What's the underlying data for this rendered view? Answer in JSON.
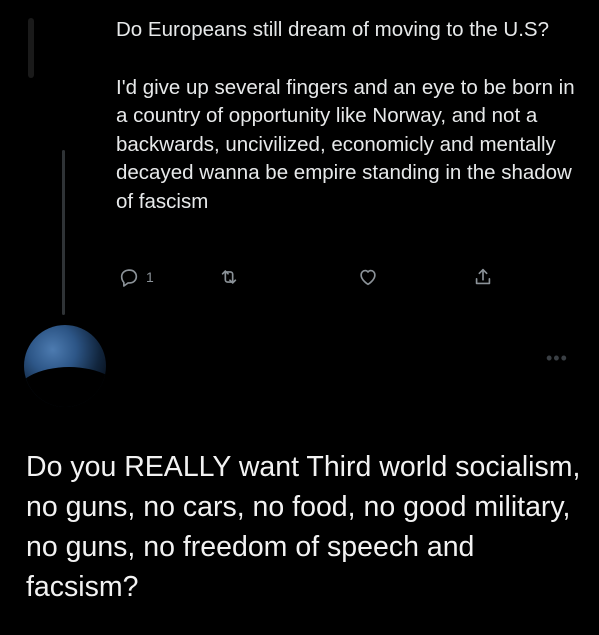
{
  "tweet": {
    "paragraph1": "Do Europeans still dream of moving to the U.S?",
    "paragraph2": "I'd give up several fingers and an eye to be born in a country of opportunity like Norway, and not a backwards, uncivilized, economicly and mentally decayed wanna be empire standing in the shadow of fascism",
    "actions": {
      "reply_count": "1",
      "reply_icon": "reply-icon",
      "retweet_icon": "retweet-icon",
      "like_icon": "heart-icon",
      "share_icon": "share-icon"
    },
    "more_label": "•••"
  },
  "caption": "Do you REALLY want Third world socialism, no guns, no cars, no food, no good military, no guns, no freedom of speech and facsism?",
  "colors": {
    "background": "#000000",
    "text": "#e7e9ea",
    "icon": "#8b9298",
    "thread_line": "#2f3336"
  }
}
